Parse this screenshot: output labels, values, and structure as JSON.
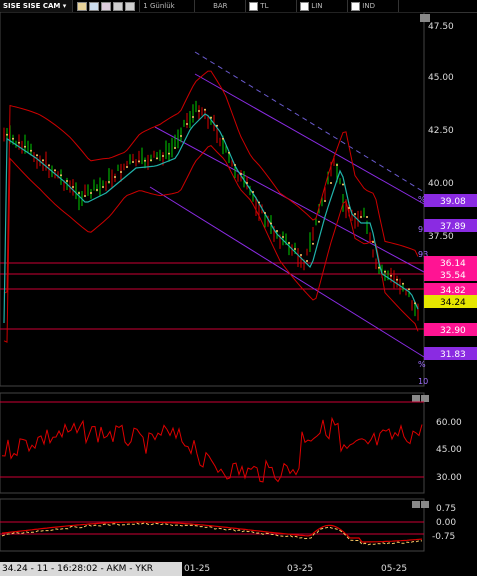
{
  "toolbar": {
    "symbol": "SISE SISE CAM",
    "period": "1 Günlük",
    "chart_type": "BAR",
    "currency": "TL",
    "scale": "LIN",
    "indicator": "IND"
  },
  "status_bar": "34.24 - 11 - 16:28:02 - AKM - YKR",
  "date_axis": [
    "01-25",
    "03-25",
    "05-25"
  ],
  "price_axis": [
    "47.50",
    "45.00",
    "42.50",
    "40.00",
    "37.50"
  ],
  "price_boxes": [
    {
      "label": "39.08",
      "color": "#8a2be2"
    },
    {
      "label": "37.89",
      "color": "#8a2be2"
    },
    {
      "label": "36.14",
      "color": "#ff1493"
    },
    {
      "label": "35.54",
      "color": "#ff1493"
    },
    {
      "label": "34.82",
      "color": "#ff1493"
    },
    {
      "label": "34.24",
      "color": "#e6e600"
    },
    {
      "label": "32.90",
      "color": "#ff1493"
    },
    {
      "label": "31.83",
      "color": "#8a2be2"
    }
  ],
  "channel_labels": [
    "%",
    "91",
    "93",
    "%",
    "10"
  ],
  "rsi_axis": [
    "60.00",
    "45.00",
    "30.00"
  ],
  "macd_axis": [
    "0.75",
    "0.00",
    "-0.75"
  ],
  "colors": {
    "background": "#000000",
    "bollinger": "#cc0000",
    "ma": "#20b2aa",
    "channel": "#8a2be2",
    "bars_up": "#00cc00",
    "bars_down": "#dd0000",
    "signal_dots": "#ffcc66",
    "hline": "#cc0033"
  }
}
